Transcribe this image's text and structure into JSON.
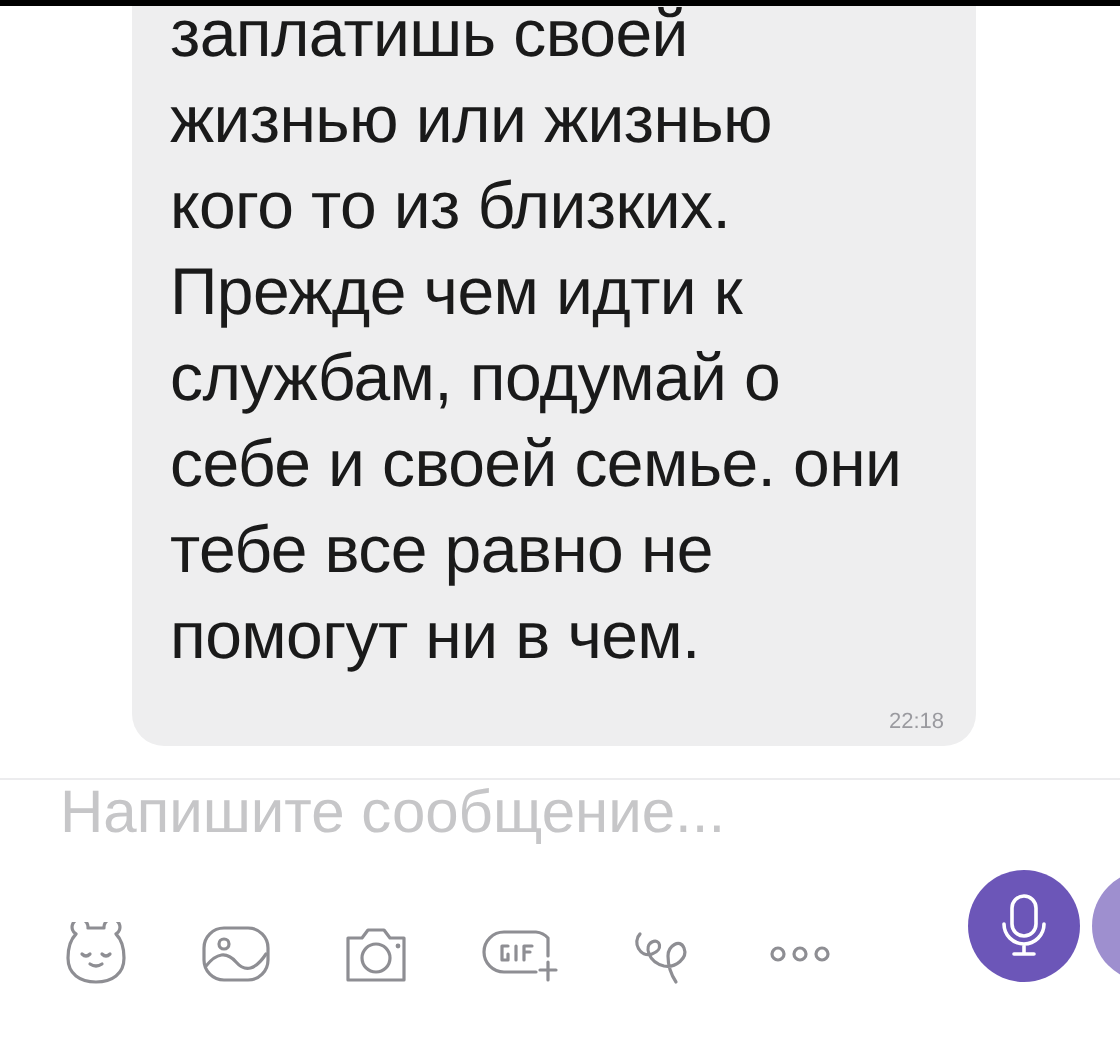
{
  "message": {
    "text": "заплатишь своей\nжизнью или жизнью\nкого то из близких.\nПрежде чем идти к\nслужбам, подумай о\nсебе и своей семье. они\nтебе все равно не\nпомогут ни в чем.",
    "time": "22:18"
  },
  "composer": {
    "placeholder": "Напишите сообщение..."
  }
}
